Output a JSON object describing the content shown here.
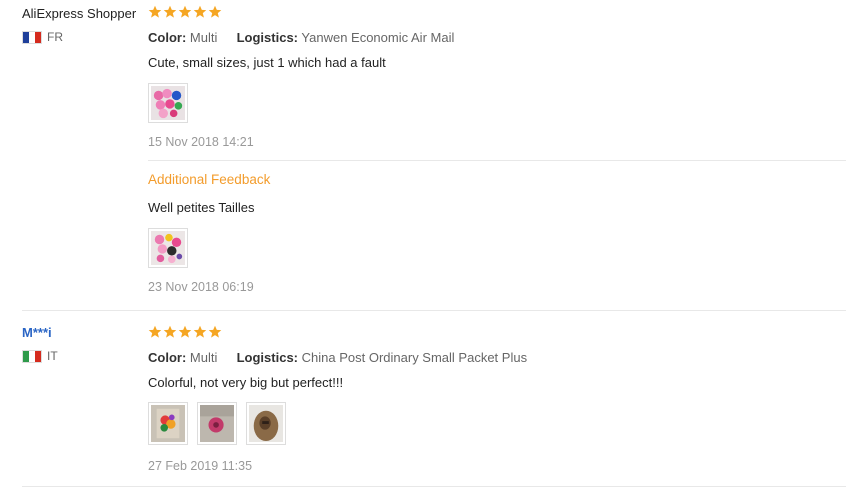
{
  "reviews": [
    {
      "user_name": "AliExpress Shopper",
      "country_code": "FR",
      "flag_colors": [
        "#1f3f9a",
        "#ffffff",
        "#d52b1e"
      ],
      "rating": 5,
      "color_label": "Color:",
      "color_value": "Multi",
      "logistics_label": "Logistics:",
      "logistics_value": "Yanwen Economic Air Mail",
      "text": "Cute, small sizes, just 1 which had a fault",
      "date": "15 Nov 2018 14:21",
      "additional_label": "Additional Feedback",
      "additional_text": "Well petites Tailles",
      "additional_date": "23 Nov 2018 06:19"
    },
    {
      "user_name": "M***i",
      "country_code": "IT",
      "flag_colors": [
        "#2e9a4a",
        "#ffffff",
        "#d52b1e"
      ],
      "rating": 5,
      "color_label": "Color:",
      "color_value": "Multi",
      "logistics_label": "Logistics:",
      "logistics_value": "China Post Ordinary Small Packet Plus",
      "text": "Colorful, not very big but perfect!!!",
      "date": "27 Feb 2019 11:35"
    }
  ],
  "colors": {
    "star": "#f5a623",
    "accent_orange": "#f39c2c",
    "link_blue": "#2a65c5"
  }
}
